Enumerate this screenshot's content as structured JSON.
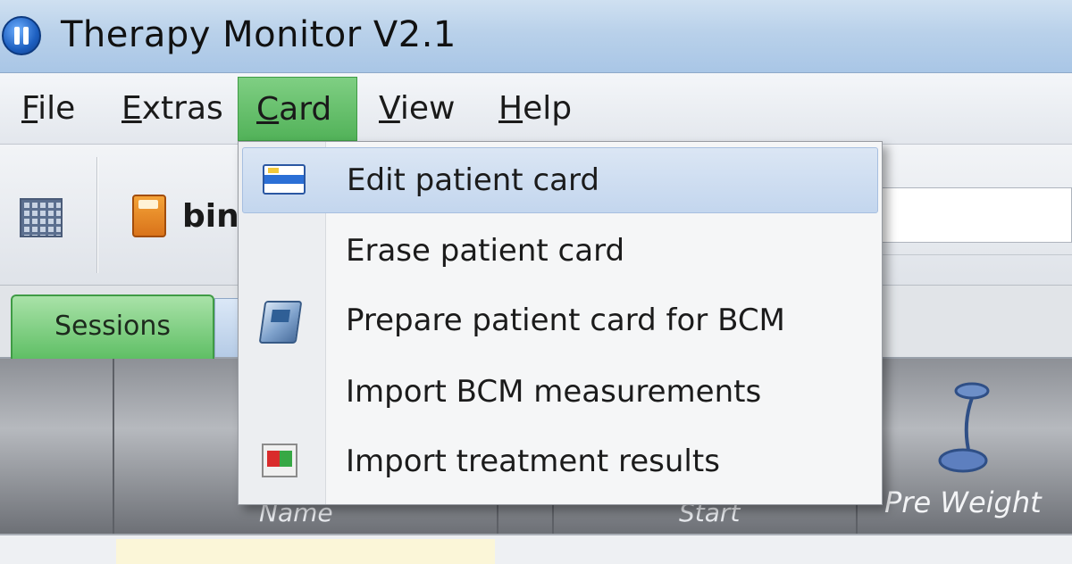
{
  "window": {
    "title": "Therapy Monitor V2.1"
  },
  "menubar": {
    "items": [
      {
        "accel": "F",
        "rest": "ile"
      },
      {
        "accel": "E",
        "rest": "xtras"
      },
      {
        "accel": "C",
        "rest": "ard"
      },
      {
        "accel": "V",
        "rest": "iew"
      },
      {
        "accel": "H",
        "rest": "elp"
      }
    ],
    "active_item": "Card"
  },
  "toolbar": {
    "partial_text": "bin"
  },
  "tabs": {
    "items": [
      {
        "label": "Sessions"
      }
    ]
  },
  "grid": {
    "headers": {
      "name": "Name",
      "start": "Start",
      "pre_weight": "Pre Weight"
    }
  },
  "card_menu": {
    "items": [
      {
        "label": "Edit patient card",
        "icon": "patient-card-icon",
        "highlighted": true
      },
      {
        "label": "Erase patient card",
        "icon": null
      },
      {
        "label": "Prepare patient card for BCM",
        "icon": "bcm-device-icon"
      },
      {
        "label": "Import BCM measurements",
        "icon": null
      },
      {
        "label": "Import treatment results",
        "icon": "import-results-icon"
      }
    ]
  },
  "colors": {
    "active_menu": "#52b259",
    "highlight": "#c3d6ee",
    "title_bar": "#b9d1ea"
  }
}
